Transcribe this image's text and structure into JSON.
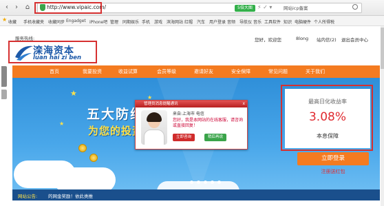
{
  "browser": {
    "url": "http://www.vipaic.com/",
    "speed_badge": "5倍大图",
    "search_text": "网站icp备案",
    "bookmarks": [
      "收藏",
      "手机收藏夹",
      "收藏同步",
      "Engadget",
      "iPhone吧",
      "管理",
      "同期娱乐",
      "手机",
      "游戏",
      "滨海网站",
      "红帽",
      "汽车",
      "用户登录",
      "音频",
      "导航仪",
      "音乐",
      "工具软件",
      "知识",
      "电脑硬件",
      "个人所得税"
    ]
  },
  "header": {
    "hotline_label": "服务热线:",
    "logo_cn": "滦海资本",
    "logo_en": "luan hai zi ben",
    "greeting": "您好，欢迎您",
    "username": "8long",
    "message": "站内信(2)",
    "logout": "退出会员中心"
  },
  "nav": {
    "items": [
      "首页",
      "我要投资",
      "收益试算",
      "会员等级",
      "邀请好友",
      "安全保障",
      "常见问题",
      "关于我们"
    ]
  },
  "banner": {
    "slogan1": "五大防线",
    "slogan2": "为您的投资",
    "slide_count": 5
  },
  "popup": {
    "title": "管理员消息提醒通讯",
    "close": "x",
    "from": "来自:上海市 电信",
    "message": "您好，我是本网站的在线客服，请咨询或直接回复！",
    "consult": "立即咨询",
    "later": "稍后再说"
  },
  "yield": {
    "label": "最高日化收益率",
    "value": "3.08%",
    "guarantee": "本息保障",
    "login": "立即登录",
    "register": "注册送红包"
  },
  "notice": {
    "label": "网站公告:",
    "text": "的网金奖励！依此类推"
  },
  "colors": {
    "accent": "#f47b20",
    "brand_blue": "#1d59a8",
    "highlight_red": "#d63030",
    "rate_red": "#e0292f"
  }
}
